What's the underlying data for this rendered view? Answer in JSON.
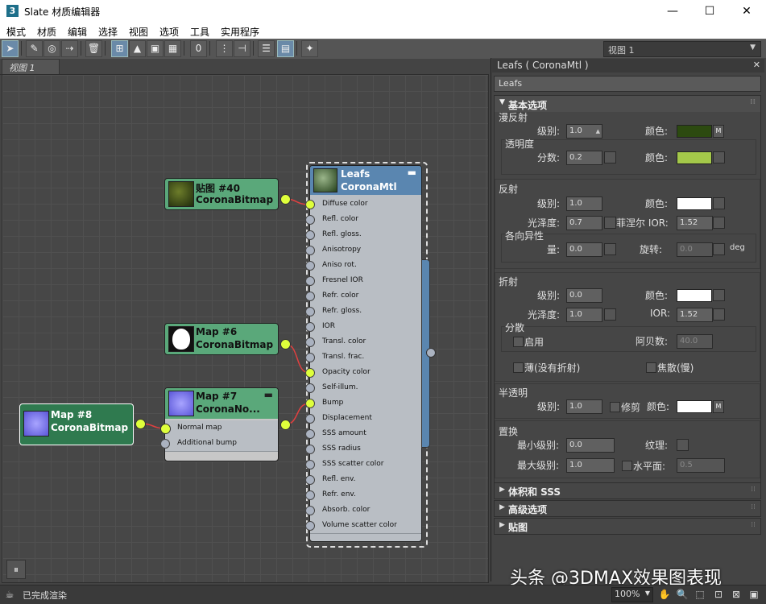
{
  "window": {
    "title": "Slate 材质编辑器",
    "app_icon": "3",
    "minimize": "—",
    "maximize": "☐",
    "close": "✕"
  },
  "menu": [
    "模式",
    "材质",
    "编辑",
    "选择",
    "视图",
    "选项",
    "工具",
    "实用程序"
  ],
  "toolbar": {
    "view_dropdown": "视图 1"
  },
  "view_tab": "视图 1",
  "nodes": {
    "map40": {
      "line1": "贴图 #40",
      "line2": "CoronaBitmap"
    },
    "map6": {
      "line1": "Map #6",
      "line2": "CoronaBitmap"
    },
    "map7": {
      "line1": "Map #7",
      "line2": "CoronaNo...",
      "slots": [
        "Normal map",
        "Additional bump"
      ]
    },
    "map8": {
      "line1": "Map #8",
      "line2": "CoronaBitmap"
    },
    "leafs": {
      "line1": "Leafs",
      "line2": "CoronaMtl",
      "slots": [
        "Diffuse color",
        "Refl. color",
        "Refl. gloss.",
        "Anisotropy",
        "Aniso rot.",
        "Fresnel IOR",
        "Refr. color",
        "Refr. gloss.",
        "IOR",
        "Transl. color",
        "Transl. frac.",
        "Opacity color",
        "Self-illum.",
        "Bump",
        "Displacement",
        "SSS amount",
        "SSS radius",
        "SSS scatter color",
        "Refl. env.",
        "Refr. env.",
        "Absorb. color",
        "Volume scatter color"
      ]
    }
  },
  "panel": {
    "title": "Leafs  ( CoronaMtl )",
    "name": "Leafs",
    "basic": {
      "header": "基本选项",
      "diffuse": {
        "label": "漫反射",
        "level_label": "级别:",
        "level": "1.0",
        "color_label": "颜色:",
        "color": "#2c4a10",
        "m": "M"
      },
      "translucency": {
        "label": "透明度",
        "fraction_label": "分数:",
        "fraction": "0.2",
        "color_label": "颜色:",
        "color": "#a4c84a"
      },
      "reflection": {
        "label": "反射",
        "level_label": "级别:",
        "level": "1.0",
        "color_label": "颜色:",
        "color": "#ffffff",
        "gloss_label": "光泽度:",
        "gloss": "0.7",
        "fresnel_label": "菲涅尔 IOR:",
        "fresnel": "1.52",
        "aniso_label": "各向异性",
        "amount_label": "量:",
        "amount": "0.0",
        "rot_label": "旋转:",
        "rot": "0.0",
        "deg": "deg"
      },
      "refraction": {
        "label": "折射",
        "level_label": "级别:",
        "level": "0.0",
        "color_label": "颜色:",
        "color": "#ffffff",
        "gloss_label": "光泽度:",
        "gloss": "1.0",
        "ior_label": "IOR:",
        "ior": "1.52",
        "disp_label": "分散",
        "enable_label": "启用",
        "abbe_label": "阿贝数:",
        "abbe": "40.0",
        "thin_label": "薄(没有折射)",
        "caustics_label": "焦散(慢)"
      },
      "opacity": {
        "label": "半透明",
        "level_label": "级别:",
        "level": "1.0",
        "clip_label": "修剪",
        "color_label": "颜色:",
        "color": "#ffffff",
        "m": "M"
      },
      "displacement": {
        "label": "置换",
        "min_label": "最小级别:",
        "min": "0.0",
        "texture_label": "纹理:",
        "max_label": "最大级别:",
        "max": "1.0",
        "water_label": "水平面:",
        "water": "0.5"
      }
    },
    "rollouts": [
      "体积和 SSS",
      "高级选项",
      "贴图"
    ]
  },
  "status": {
    "text": "已完成渲染",
    "zoom": "100%"
  },
  "watermark": "头条 @3DMAX效果图表现"
}
